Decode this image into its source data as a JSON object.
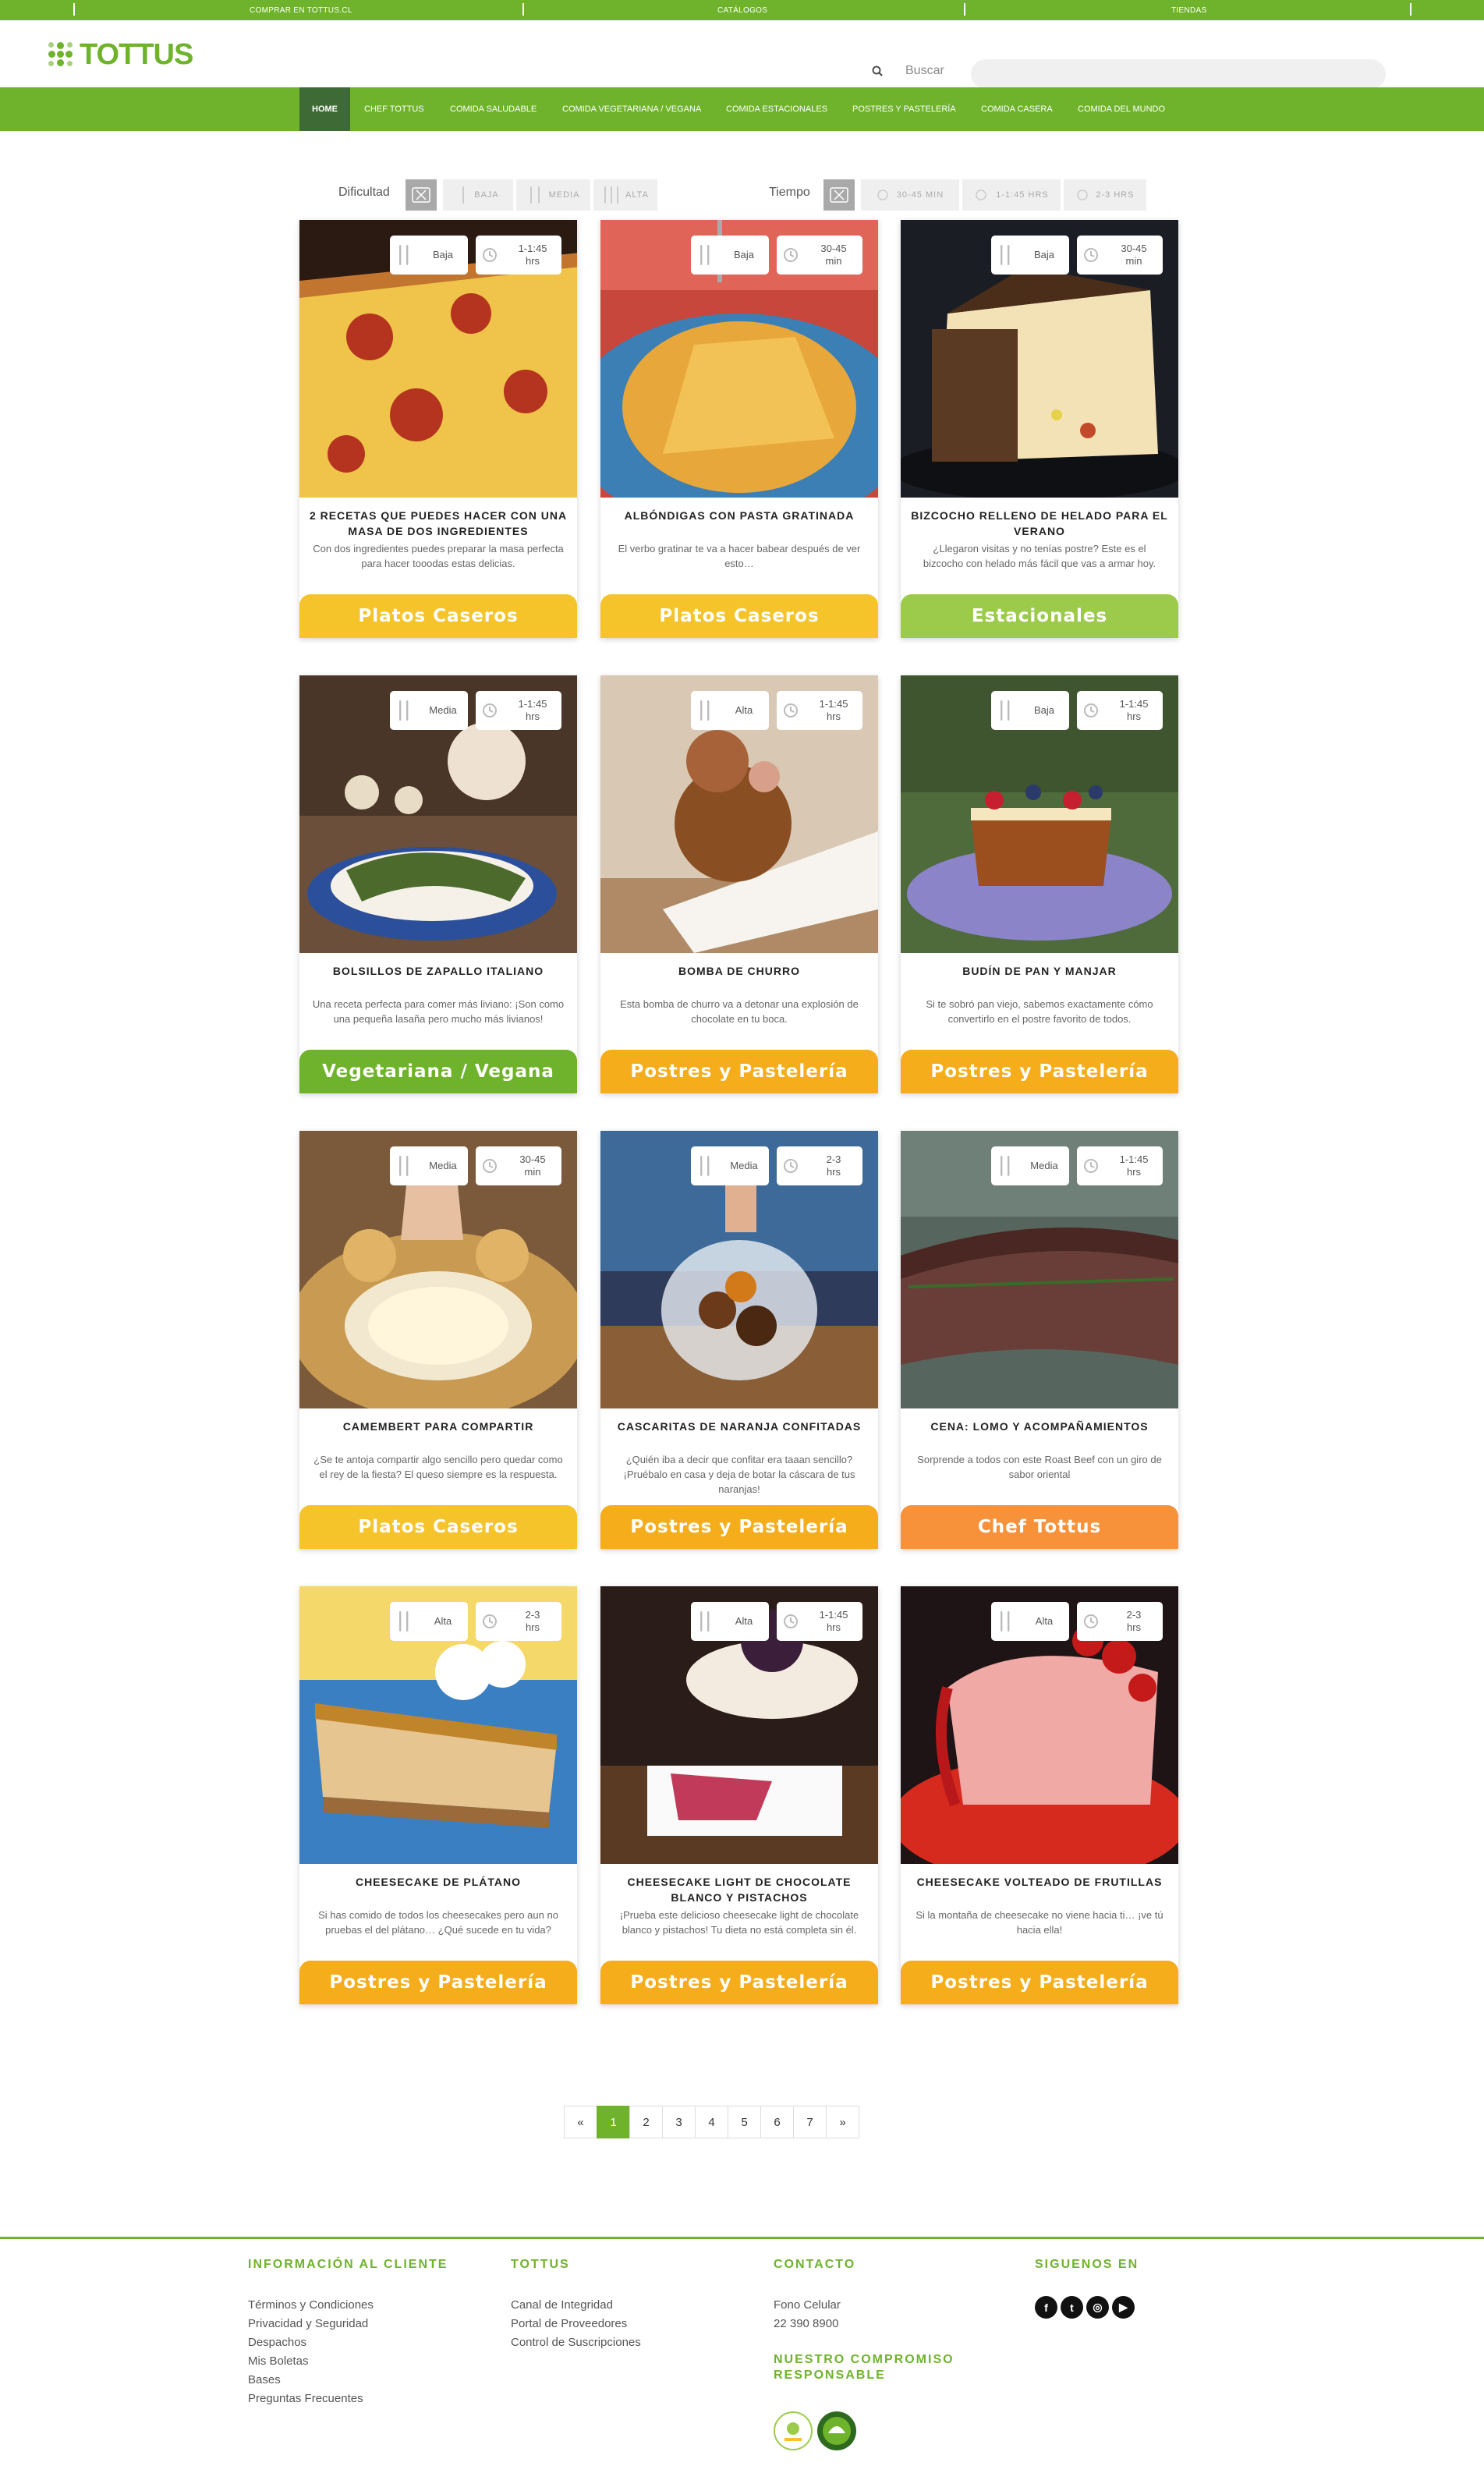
{
  "topbar": {
    "links": [
      "COMPRAR EN TOTTUS.CL",
      "CATÁLOGOS",
      "TIENDAS"
    ]
  },
  "header": {
    "logo_text": "TOTTUS",
    "search_label": "Buscar",
    "search_placeholder": ""
  },
  "nav": {
    "items": [
      "HOME",
      "CHEF TOTTUS",
      "COMIDA SALUDABLE",
      "COMIDA VEGETARIANA / VEGANA",
      "COMIDA ESTACIONALES",
      "POSTRES Y PASTELERÍA",
      "COMIDA CASERA",
      "COMIDA DEL MUNDO"
    ],
    "active": "HOME"
  },
  "filters": {
    "difficulty_label": "Dificultad",
    "difficulty_options": [
      "BAJA",
      "MEDIA",
      "ALTA"
    ],
    "time_label": "Tiempo",
    "time_options": [
      "30-45 MIN",
      "1-1:45 HRS",
      "2-3 HRS"
    ]
  },
  "colors": {
    "brand_green": "#6fb32c",
    "nav_active": "#3e6a35",
    "platos_caseros": "#f5c32a",
    "estacionales": "#9ccb4c",
    "vegetariana": "#6fb32c",
    "postres": "#f5ad1c",
    "chef_tottus": "#f7913a"
  },
  "recipes": [
    {
      "difficulty": "Baja",
      "time": "1-1:45\nhrs",
      "title": "2 RECETAS QUE PUEDES HACER CON UNA MASA DE DOS INGREDIENTES",
      "description": "Con dos ingredientes puedes preparar la masa perfecta para hacer tooodas estas delicias.",
      "category": "Platos Caseros"
    },
    {
      "difficulty": "Baja",
      "time": "30-45\nmin",
      "title": "ALBÓNDIGAS CON PASTA GRATINADA",
      "description": "El verbo gratinar te va a hacer babear después de ver esto…",
      "category": "Platos Caseros"
    },
    {
      "difficulty": "Baja",
      "time": "30-45\nmin",
      "title": "BIZCOCHO RELLENO DE HELADO PARA EL VERANO",
      "description": "¿Llegaron visitas y no tenías postre? Este es el bizcocho con helado más fácil que vas a armar hoy.",
      "category": "Estacionales"
    },
    {
      "difficulty": "Media",
      "time": "1-1:45\nhrs",
      "title": "BOLSILLOS DE ZAPALLO ITALIANO",
      "description": "Una receta perfecta para comer más liviano: ¡Son como una pequeña lasaña pero mucho más livianos!",
      "category": "Vegetariana / Vegana"
    },
    {
      "difficulty": "Alta",
      "time": "1-1:45\nhrs",
      "title": "BOMBA DE CHURRO",
      "description": "Esta bomba de churro va a detonar una explosión de chocolate en tu boca.",
      "category": "Postres y Pastelería"
    },
    {
      "difficulty": "Baja",
      "time": "1-1:45\nhrs",
      "title": "BUDÍN DE PAN Y MANJAR",
      "description": "Si te sobró pan viejo, sabemos exactamente cómo convertirlo en el postre favorito de todos.",
      "category": "Postres y Pastelería"
    },
    {
      "difficulty": "Media",
      "time": "30-45\nmin",
      "title": "CAMEMBERT PARA COMPARTIR",
      "description": "¿Se te antoja compartir algo sencillo pero quedar como el rey de la fiesta? El queso siempre es la respuesta.",
      "category": "Platos Caseros"
    },
    {
      "difficulty": "Media",
      "time": "2-3\nhrs",
      "title": "CASCARITAS DE NARANJA CONFITADAS",
      "description": "¿Quién iba a decir que confitar era taaan sencillo? ¡Pruébalo en casa y deja de botar la cáscara de tus naranjas!",
      "category": "Postres y Pastelería"
    },
    {
      "difficulty": "Media",
      "time": "1-1:45\nhrs",
      "title": "CENA: LOMO Y ACOMPAÑAMIENTOS",
      "description": "Sorprende a todos con este Roast Beef con un giro de sabor oriental",
      "category": "Chef Tottus"
    },
    {
      "difficulty": "Alta",
      "time": "2-3\nhrs",
      "title": "CHEESECAKE DE PLÁTANO",
      "description": "Si has comido de todos los cheesecakes pero aun no pruebas el del plátano… ¿Qué sucede en tu vida?",
      "category": "Postres y Pastelería"
    },
    {
      "difficulty": "Alta",
      "time": "1-1:45\nhrs",
      "title": "CHEESECAKE LIGHT DE CHOCOLATE BLANCO Y PISTACHOS",
      "description": "¡Prueba este delicioso cheesecake light de chocolate blanco y pistachos! Tu dieta no está completa sin él.",
      "category": "Postres y Pastelería"
    },
    {
      "difficulty": "Alta",
      "time": "2-3\nhrs",
      "title": "CHEESECAKE VOLTEADO DE FRUTILLAS",
      "description": "Si la montaña de cheesecake no viene hacia ti… ¡ve tú hacia ella!",
      "category": "Postres y Pastelería"
    }
  ],
  "pagination": {
    "prev": "«",
    "pages": [
      "1",
      "2",
      "3",
      "4",
      "5",
      "6",
      "7"
    ],
    "next": "»",
    "current": "1"
  },
  "footer": {
    "col1_title": "INFORMACIÓN AL CLIENTE",
    "col1_links": [
      "Términos y Condiciones",
      "Privacidad y Seguridad",
      "Despachos",
      "Mis Boletas",
      "Bases",
      "Preguntas Frecuentes"
    ],
    "col2_title": "TOTTUS",
    "col2_links": [
      "Canal de Integridad",
      "Portal de Proveedores",
      "Control de Suscripciones"
    ],
    "col3_title": "CONTACTO",
    "contact_label": "Fono Celular",
    "contact_phone": "22 390 8900",
    "commitment_title": "NUESTRO COMPROMISO RESPONSABLE",
    "col4_title": "SIGUENOS EN",
    "social": [
      "facebook-icon",
      "twitter-icon",
      "instagram-icon",
      "youtube-icon"
    ]
  }
}
